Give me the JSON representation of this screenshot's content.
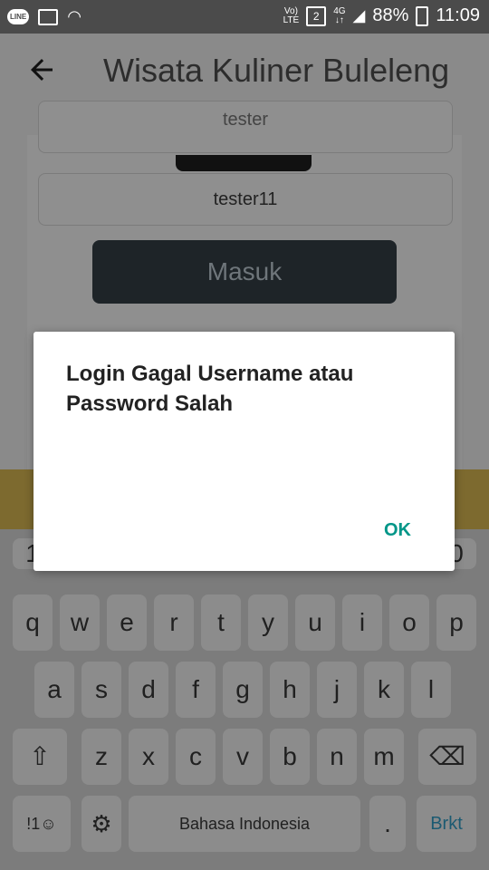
{
  "statusbar": {
    "app_line": "LINE",
    "volte_top": "Vo)",
    "volte_bottom": "LTE",
    "sim": "2",
    "network_top": "4G",
    "network_bottom": "↓↑",
    "battery": "88%",
    "time": "11:09"
  },
  "appbar": {
    "back_icon": "back-arrow",
    "title": "Wisata Kuliner Buleleng"
  },
  "form": {
    "username_value": "tester",
    "password_value": "tester11",
    "login_button": "Masuk"
  },
  "dialog": {
    "message": "Login Gagal Username atau Password Salah",
    "ok_label": "OK"
  },
  "keyboard": {
    "row1": [
      "q",
      "w",
      "e",
      "r",
      "t",
      "y",
      "u",
      "i",
      "o",
      "p"
    ],
    "row2": [
      "a",
      "s",
      "d",
      "f",
      "g",
      "h",
      "j",
      "k",
      "l"
    ],
    "row3": [
      "z",
      "x",
      "c",
      "v",
      "b",
      "n",
      "m"
    ],
    "shift_icon": "shift",
    "backspace_icon": "backspace",
    "symbols_label": "!1☺",
    "settings_icon": "gear",
    "space_label": "Bahasa Indonesia",
    "period_label": ".",
    "enter_label": "Brkt"
  },
  "colors": {
    "accent": "#009688",
    "banner_yellow": "#f1c232"
  }
}
